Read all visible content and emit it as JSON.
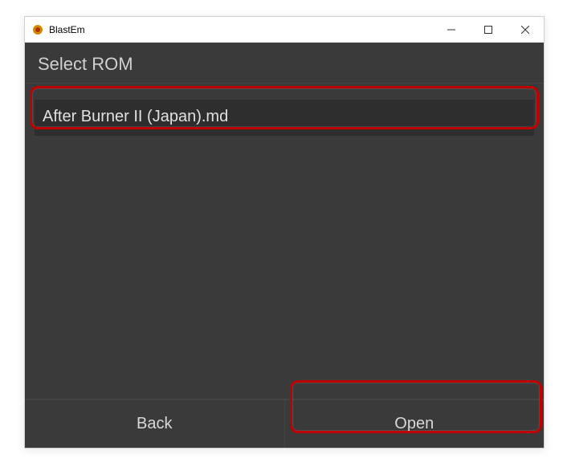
{
  "window": {
    "title": "BlastEm"
  },
  "header": {
    "title": "Select ROM"
  },
  "fileList": {
    "items": [
      {
        "filename": "After Burner II (Japan).md"
      }
    ]
  },
  "buttons": {
    "back": "Back",
    "open": "Open"
  }
}
